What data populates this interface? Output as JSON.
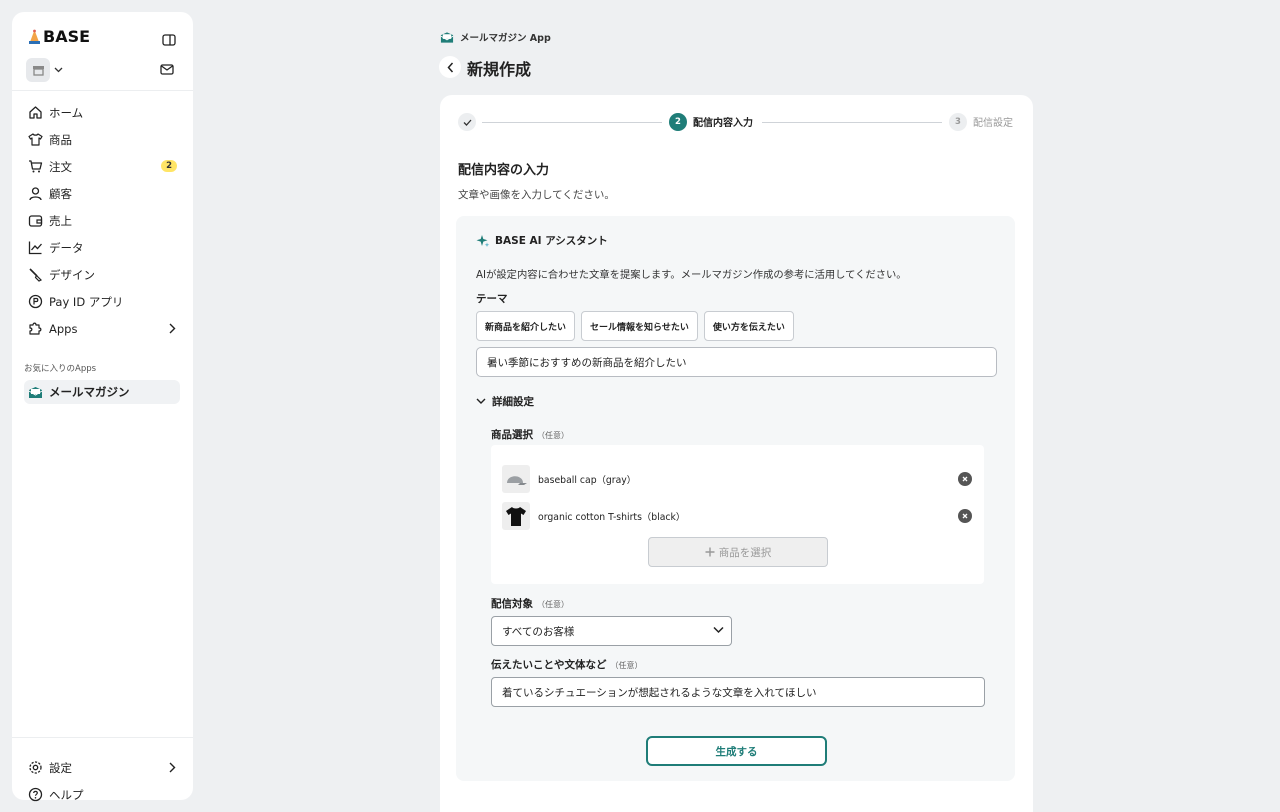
{
  "brand": {
    "name": "BASE",
    "accent": "#1f7d78",
    "badge_color": "#ffe566"
  },
  "sidebar": {
    "items": [
      {
        "label": "ホーム",
        "icon": "home-icon"
      },
      {
        "label": "商品",
        "icon": "shirt-icon"
      },
      {
        "label": "注文",
        "icon": "cart-icon",
        "badge": "2"
      },
      {
        "label": "顧客",
        "icon": "user-icon"
      },
      {
        "label": "売上",
        "icon": "wallet-icon"
      },
      {
        "label": "データ",
        "icon": "chart-icon"
      },
      {
        "label": "デザイン",
        "icon": "brush-icon"
      },
      {
        "label": "Pay ID アプリ",
        "icon": "payid-icon"
      },
      {
        "label": "Apps",
        "icon": "puzzle-icon"
      }
    ],
    "favorites_label": "お気に入りのApps",
    "favorite_app": "メールマガジン",
    "bottom": [
      {
        "label": "設定",
        "icon": "gear-icon"
      },
      {
        "label": "ヘルプ",
        "icon": "help-icon"
      }
    ]
  },
  "header": {
    "app_name": "メールマガジン App",
    "title": "新規作成"
  },
  "stepper": {
    "steps": [
      {
        "number": "1",
        "label": "",
        "state": "done"
      },
      {
        "number": "2",
        "label": "配信内容入力",
        "state": "active"
      },
      {
        "number": "3",
        "label": "配信設定",
        "state": "pending"
      }
    ]
  },
  "content": {
    "title": "配信内容の入力",
    "subtitle": "文章や画像を入力してください。"
  },
  "ai": {
    "title": "BASE AI アシスタント",
    "description": "AIが設定内容に合わせた文章を提案します。メールマガジン作成の参考に活用してください。",
    "theme_label": "テーマ",
    "chips": [
      "新商品を紹介したい",
      "セール情報を知らせたい",
      "使い方を伝えたい"
    ],
    "theme_value": "暑い季節におすすめの新商品を紹介したい",
    "detail_label": "詳細設定",
    "product_label": "商品選択",
    "optional": "（任意）",
    "products": [
      {
        "name": "baseball cap（gray）"
      },
      {
        "name": "organic cotton T-shirts（black）"
      }
    ],
    "add_product": "商品を選択",
    "target_label": "配信対象",
    "target_value": "すべてのお客様",
    "style_label": "伝えたいことや文体など",
    "style_value": "着ているシチュエーションが想起されるような文章を入れてほしい",
    "generate": "生成する"
  }
}
